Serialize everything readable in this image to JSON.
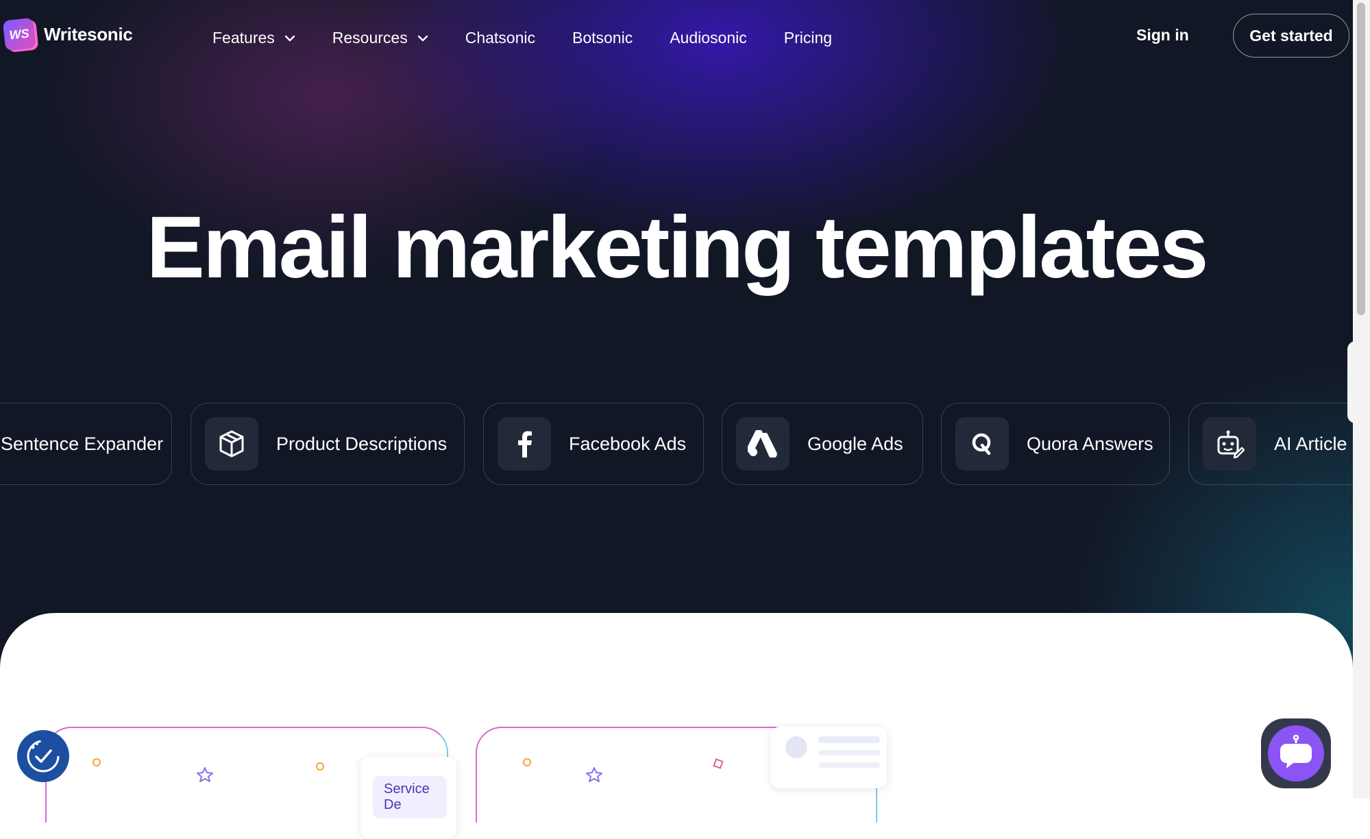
{
  "brand": {
    "name": "Writesonic",
    "mark": "WS"
  },
  "nav": {
    "items": [
      {
        "label": "Features",
        "dropdown": true
      },
      {
        "label": "Resources",
        "dropdown": true
      },
      {
        "label": "Chatsonic",
        "dropdown": false
      },
      {
        "label": "Botsonic",
        "dropdown": false
      },
      {
        "label": "Audiosonic",
        "dropdown": false
      },
      {
        "label": "Pricing",
        "dropdown": false
      }
    ],
    "sign_in": "Sign in",
    "get_started": "Get started"
  },
  "hero": {
    "title": "Email marketing templates"
  },
  "tools": [
    {
      "label": "Sentence Expander",
      "icon": "none"
    },
    {
      "label": "Product Descriptions",
      "icon": "box-icon"
    },
    {
      "label": "Facebook Ads",
      "icon": "facebook-icon"
    },
    {
      "label": "Google Ads",
      "icon": "google-ads-icon"
    },
    {
      "label": "Quora Answers",
      "icon": "quora-icon"
    },
    {
      "label": "AI Article",
      "icon": "ai-robot-icon"
    }
  ],
  "cards": [
    {
      "tag": "Service De"
    },
    {
      "tag": ""
    }
  ],
  "colors": {
    "background": "#121726",
    "accent_purple": "#8c54f5",
    "accessibility_blue": "#1c4fa1"
  }
}
